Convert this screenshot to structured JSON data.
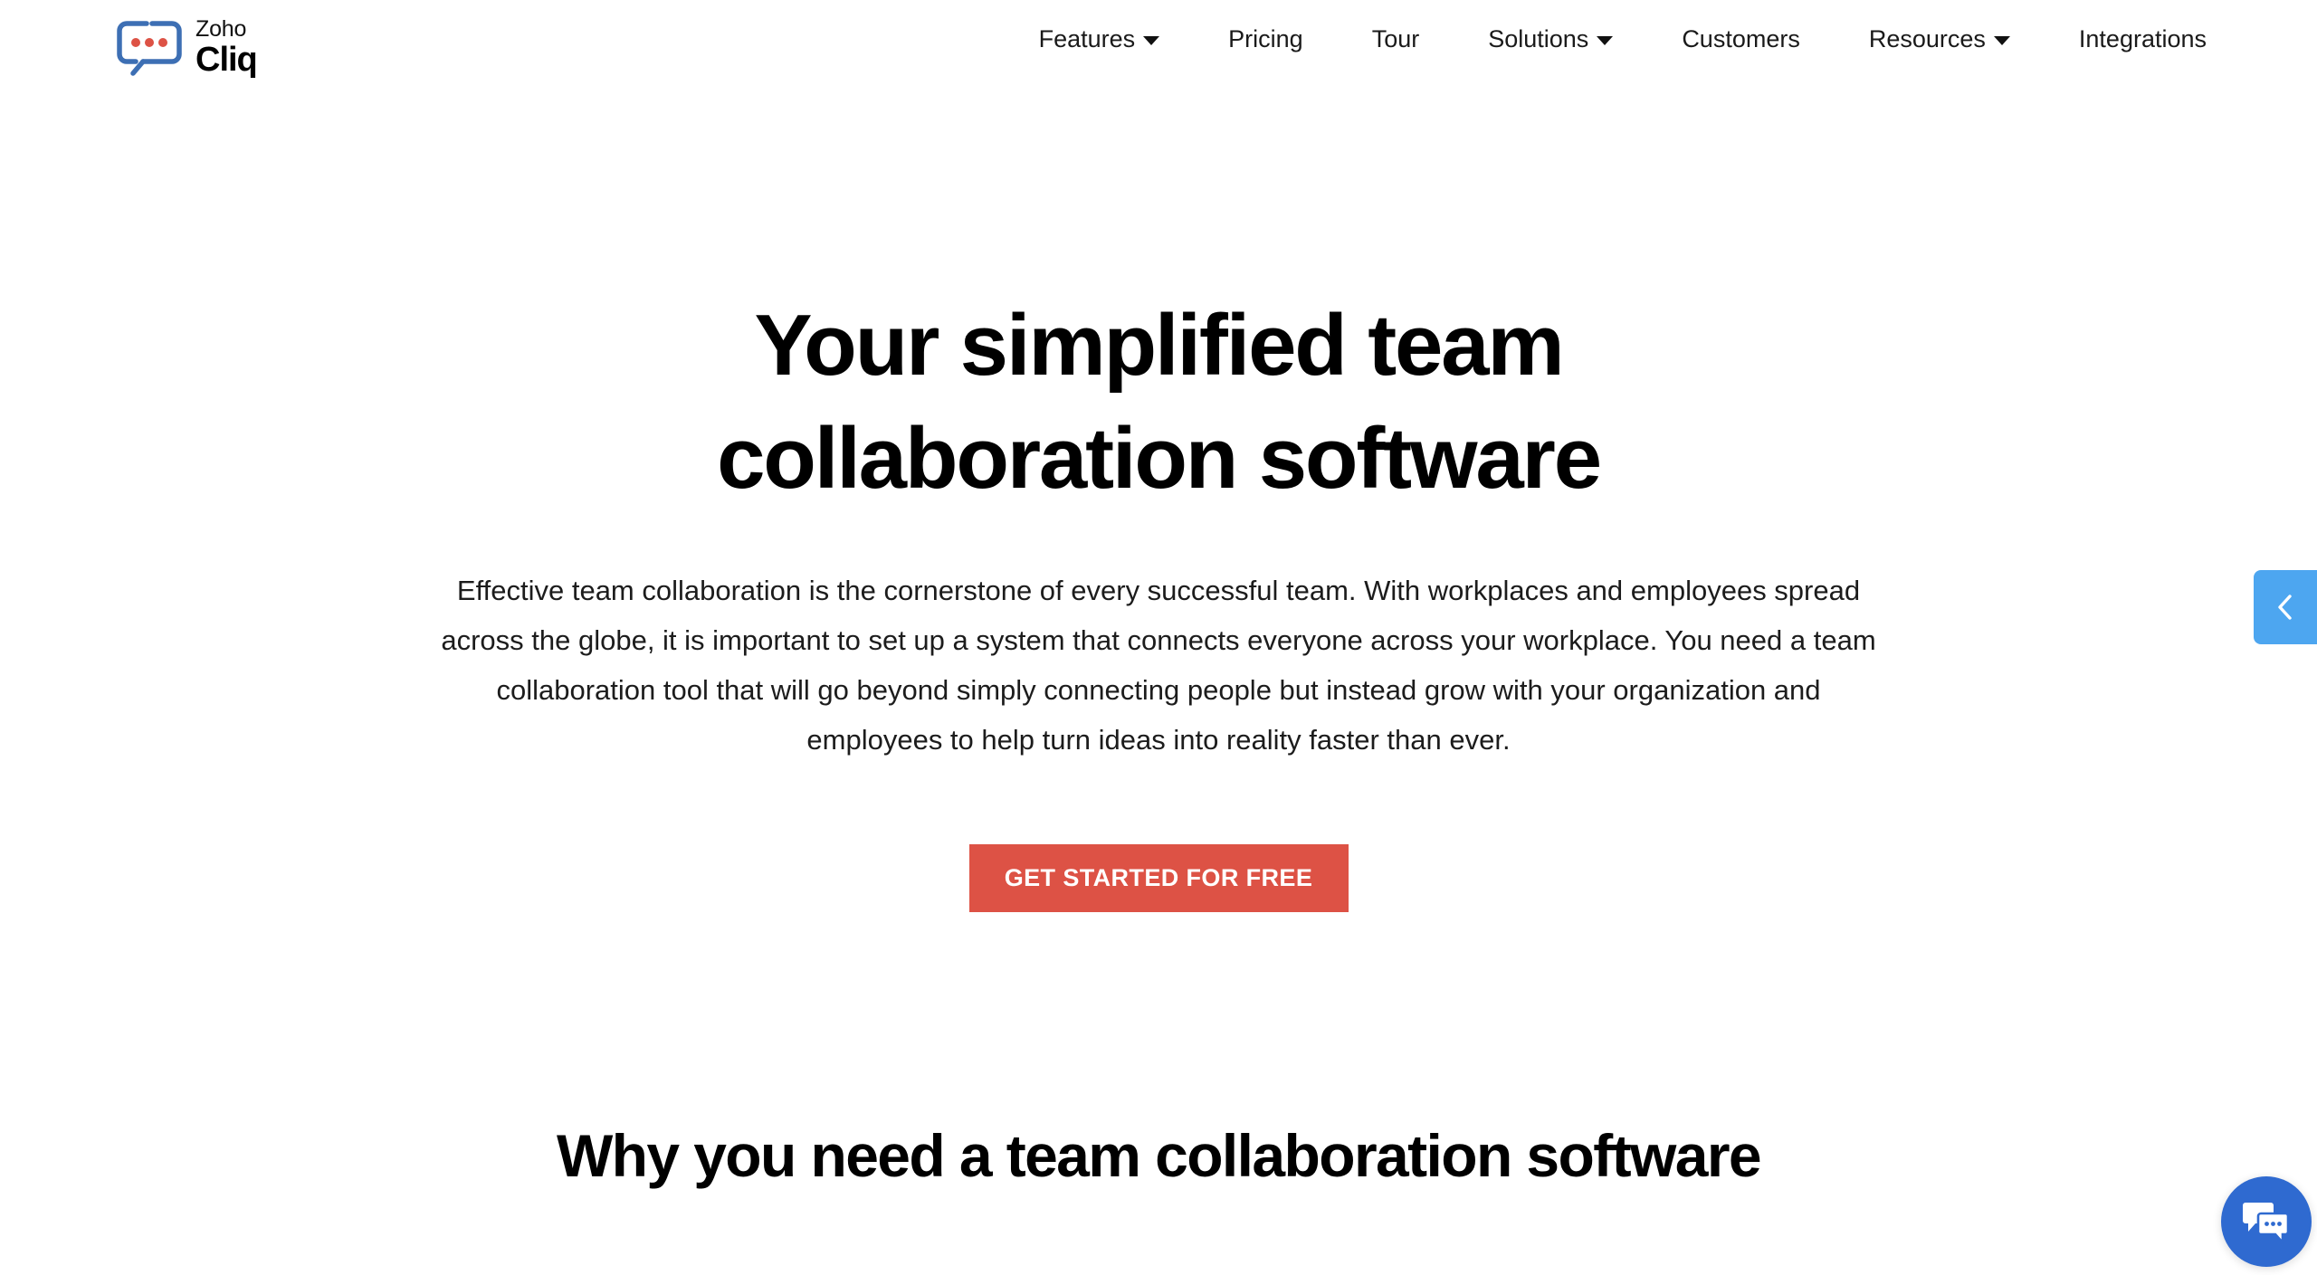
{
  "page": {
    "background_color": "#ffffff",
    "text_color": "#1a1a1a"
  },
  "header": {
    "brand": {
      "name_top": "Zoho",
      "name_bottom": "Cliq",
      "logo_icon": "chat-bubble-logo-icon",
      "logo_outline_color": "#3d6fb4",
      "logo_dot_color": "#dd5245"
    },
    "nav": [
      {
        "label": "Features",
        "has_dropdown": true,
        "caret_icon": "chevron-down-icon"
      },
      {
        "label": "Pricing",
        "has_dropdown": false,
        "caret_icon": ""
      },
      {
        "label": "Tour",
        "has_dropdown": false,
        "caret_icon": ""
      },
      {
        "label": "Solutions",
        "has_dropdown": true,
        "caret_icon": "chevron-down-icon"
      },
      {
        "label": "Customers",
        "has_dropdown": false,
        "caret_icon": ""
      },
      {
        "label": "Resources",
        "has_dropdown": true,
        "caret_icon": "chevron-down-icon"
      },
      {
        "label": "Integrations",
        "has_dropdown": false,
        "caret_icon": ""
      }
    ]
  },
  "hero": {
    "title": "Your simplified team collaboration software",
    "description": "Effective team collaboration is the cornerstone of every successful team. With workplaces and employees spread across the globe, it is important to set up a system that connects everyone across your workplace. You need a team collaboration tool that will go beyond simply connecting people but instead grow with your organization and employees to help turn ideas into reality faster than ever.",
    "cta": {
      "label": "GET STARTED FOR FREE",
      "background_color": "#dd5245",
      "text_color": "#ffffff"
    }
  },
  "section_two": {
    "heading": "Why you need a team collaboration software"
  },
  "side_tab": {
    "icon": "chevron-left-icon",
    "background_color": "#4da6f0",
    "icon_color": "#ffffff"
  },
  "chat_widget": {
    "icon": "chat-bubbles-icon",
    "background_color": "#2f6ad0",
    "icon_color": "#ffffff"
  }
}
